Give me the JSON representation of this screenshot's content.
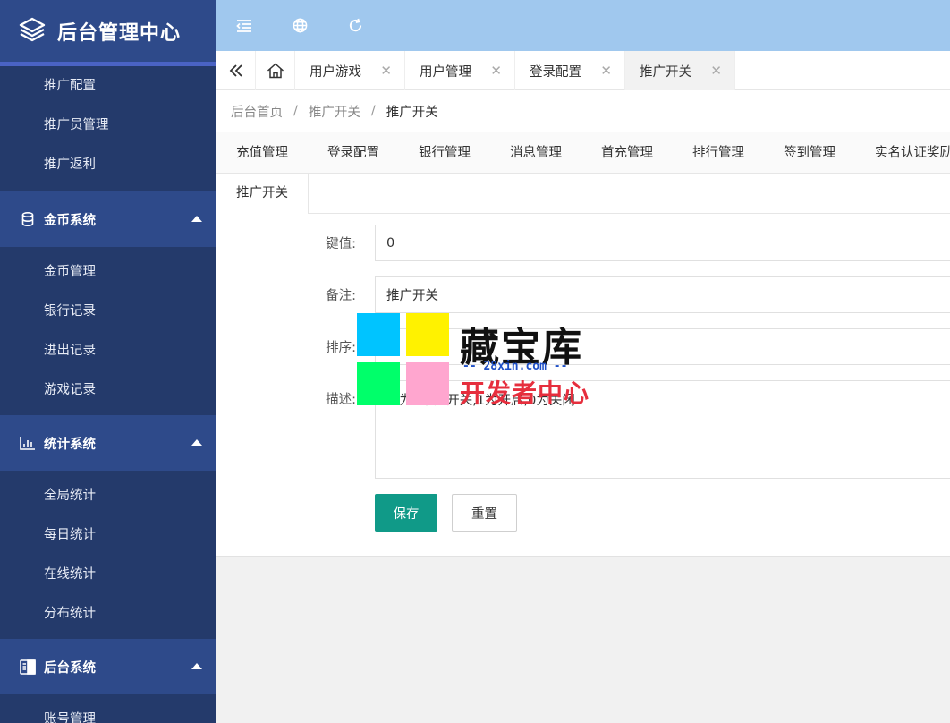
{
  "app": {
    "title": "后台管理中心"
  },
  "sidebar": {
    "top_items": [
      "推广配置",
      "推广员管理",
      "推广返利"
    ],
    "groups": [
      {
        "label": "金币系统",
        "items": [
          "金币管理",
          "银行记录",
          "进出记录",
          "游戏记录"
        ]
      },
      {
        "label": "统计系统",
        "items": [
          "全局统计",
          "每日统计",
          "在线统计",
          "分布统计"
        ]
      },
      {
        "label": "后台系统",
        "items": [
          "账号管理"
        ]
      }
    ]
  },
  "tabs": [
    {
      "label": "用户游戏"
    },
    {
      "label": "用户管理"
    },
    {
      "label": "登录配置"
    },
    {
      "label": "推广开关",
      "active": true
    }
  ],
  "breadcrumb": {
    "home": "后台首页",
    "parent": "推广开关",
    "current": "推广开关",
    "separator": "/"
  },
  "subtabs": [
    "充值管理",
    "登录配置",
    "银行管理",
    "消息管理",
    "首充管理",
    "排行管理",
    "签到管理",
    "实名认证奖励"
  ],
  "subtabs_row2": [
    "推广开关"
  ],
  "form": {
    "key_label": "键值:",
    "key_value": "0",
    "note_label": "备注:",
    "note_value": "推广开关",
    "sort_label": "排序:",
    "sort_value": "1",
    "desc_label": "描述:",
    "desc_value": "值为0推广开关,1为开启,0为关闭"
  },
  "buttons": {
    "save": "保存",
    "reset": "重置"
  },
  "watermark": {
    "title": "藏宝库",
    "url": "-- 28xin.com --",
    "subtitle": "开发者中心"
  },
  "colors": {
    "sidebar": "#243a6b",
    "header": "#a0c8ee",
    "primary": "#109a88"
  }
}
